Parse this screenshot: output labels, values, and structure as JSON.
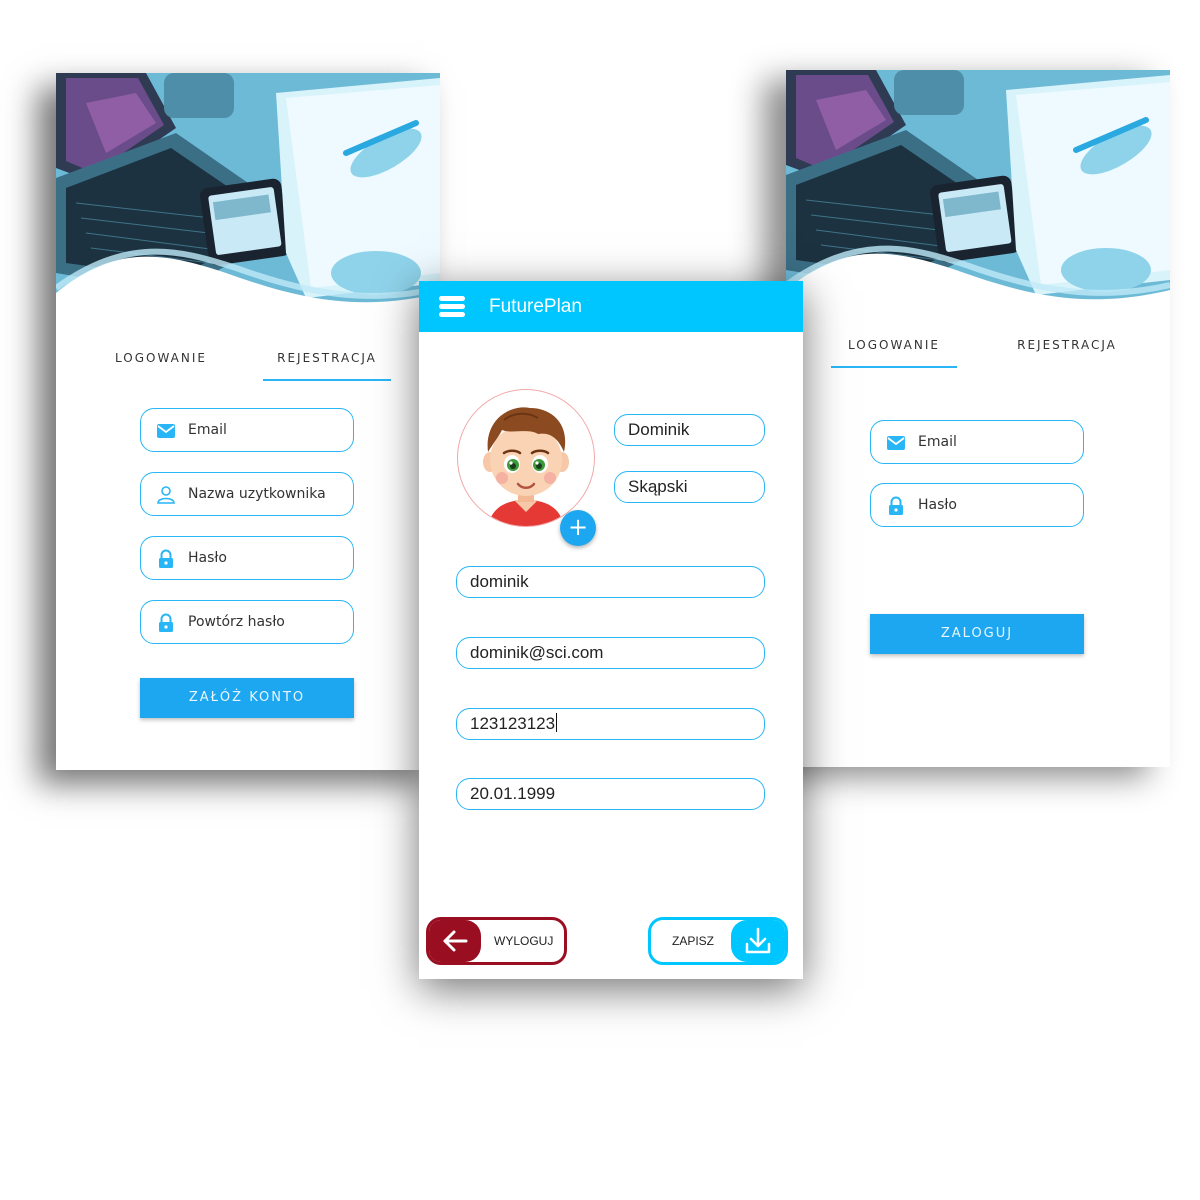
{
  "colors": {
    "accent": "#29b6f6",
    "appbar": "#00c6ff",
    "button": "#1ea7f1",
    "logout": "#9a0e22"
  },
  "register_screen": {
    "tabs": [
      {
        "label": "LOGOWANIE"
      },
      {
        "label": "REJESTRACJA",
        "active": true
      }
    ],
    "fields": [
      {
        "label": "Email",
        "icon": "mail-icon"
      },
      {
        "label": "Nazwa uzytkownika",
        "icon": "user-icon"
      },
      {
        "label": "Hasło",
        "icon": "lock-icon"
      },
      {
        "label": "Powtórz hasło",
        "icon": "lock-icon"
      }
    ],
    "submit_label": "ZAŁÓŻ KONTO"
  },
  "profile_screen": {
    "app_title": "FuturePlan",
    "first_name": "Dominik",
    "last_name": "Skąpski",
    "username": "dominik",
    "email": "dominik@sci.com",
    "phone": "123123123",
    "birth_date": "20.01.1999",
    "add_photo_symbol": "+",
    "logout_label": "WYLOGUJ",
    "save_label": "ZAPISZ"
  },
  "login_screen": {
    "tabs": [
      {
        "label": "LOGOWANIE",
        "active": true
      },
      {
        "label": "REJESTRACJA"
      }
    ],
    "fields": [
      {
        "label": "Email",
        "icon": "mail-icon"
      },
      {
        "label": "Hasło",
        "icon": "lock-icon"
      }
    ],
    "submit_label": "ZALOGUJ"
  }
}
